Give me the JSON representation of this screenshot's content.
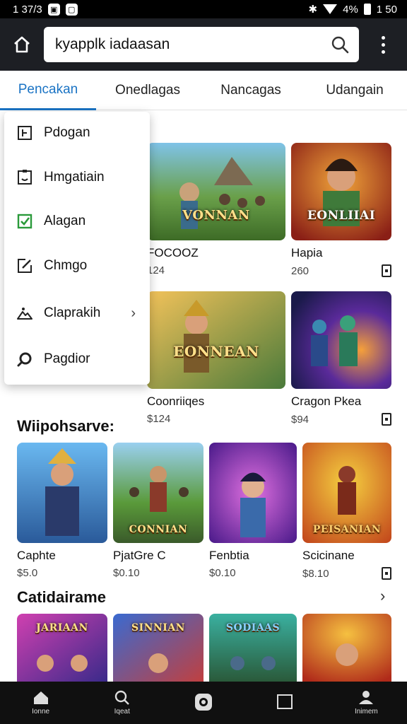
{
  "status_bar": {
    "time": "1 37/3",
    "battery": "4%",
    "clock": "1 50"
  },
  "search": {
    "value": "kyapplk iadaasan"
  },
  "tabs": [
    {
      "label": "Pencakan",
      "active": true
    },
    {
      "label": "Onedlagas",
      "active": false
    },
    {
      "label": "Nancagas",
      "active": false
    },
    {
      "label": "Udangain",
      "active": false
    }
  ],
  "menu": {
    "items": [
      {
        "label": "Pdogan",
        "icon": "grid-icon"
      },
      {
        "label": "Hmgatiain",
        "icon": "smiley-box-icon"
      },
      {
        "label": "Alagan",
        "icon": "checkbox-icon"
      },
      {
        "label": "Chmgo",
        "icon": "edit-icon"
      },
      {
        "label": "Claprakih",
        "icon": "mountain-icon",
        "has_submenu": true
      },
      {
        "label": "Pagdior",
        "icon": "search-icon"
      }
    ]
  },
  "top_grid": [
    {
      "name": "FOCOOZ",
      "price": "124",
      "thumb_title": "VONNAN"
    },
    {
      "name": "Hapia",
      "price": "260",
      "thumb_title": "EONLIIAI"
    },
    {
      "name": "Coonriiqes",
      "price": "$124",
      "thumb_title": "EONNEAN"
    },
    {
      "name": "Cragon Pkea",
      "price": "$94",
      "thumb_title": ""
    }
  ],
  "section1": {
    "title": "Wiipohsarve:",
    "items": [
      {
        "name": "Caphte",
        "price": "$5.0",
        "thumb_title": ""
      },
      {
        "name": "PjatGre C",
        "price": "$0.10",
        "thumb_title": "CONNIAN"
      },
      {
        "name": "Fenbtia",
        "price": "$0.10",
        "thumb_title": ""
      },
      {
        "name": "Scicinane",
        "price": "$8.10",
        "thumb_title": "PEISANIAN"
      }
    ]
  },
  "section2": {
    "title": "Catidairame",
    "items": [
      {
        "name": "",
        "thumb_title": "JARIAAN"
      },
      {
        "name": "",
        "thumb_title": "SINNIAN"
      },
      {
        "name": "",
        "thumb_title": "SODIAAS"
      },
      {
        "name": "",
        "thumb_title": ""
      }
    ]
  },
  "bottom_nav": [
    {
      "label": "Ionne",
      "icon": "home-icon"
    },
    {
      "label": "Iqeat",
      "icon": "search-icon"
    },
    {
      "label": "",
      "icon": "camera-icon"
    },
    {
      "label": "",
      "icon": "square-icon"
    },
    {
      "label": "Inimem",
      "icon": "profile-icon"
    }
  ],
  "colors": {
    "accent": "#1a73c4",
    "appbar": "#1d1f24",
    "bottom_nav": "#101010"
  }
}
